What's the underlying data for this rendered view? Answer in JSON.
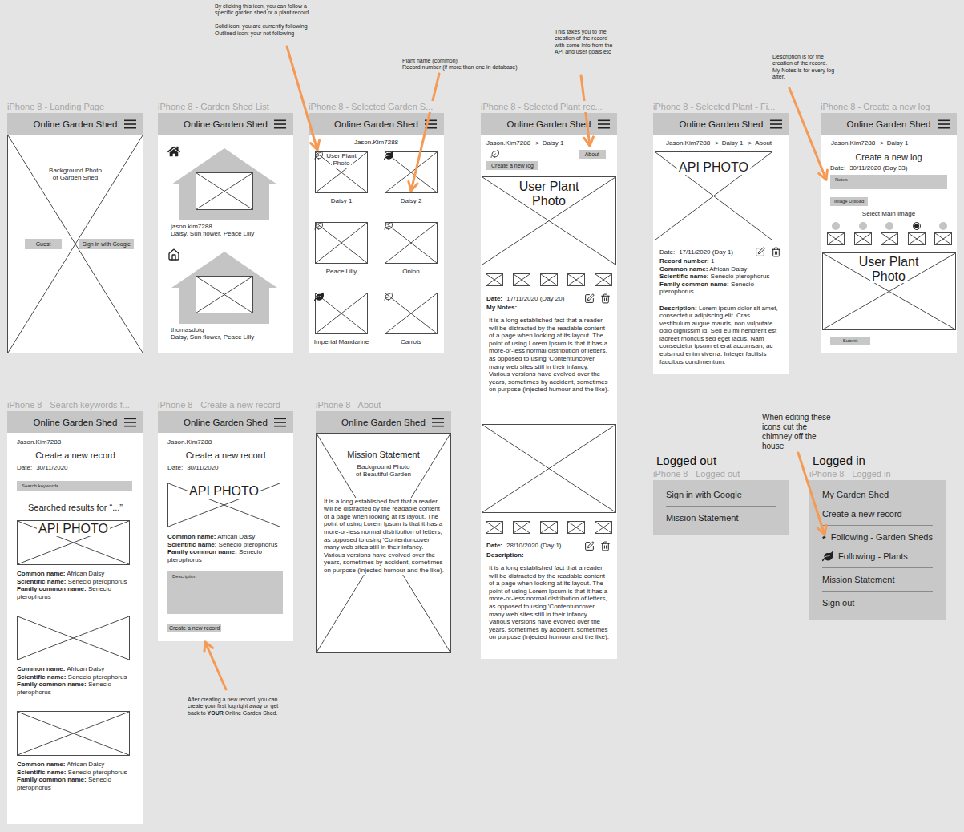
{
  "app_title": "Online Garden Shed",
  "landing": {
    "label": "iPhone 8 - Landing Page",
    "photo": [
      "Background Photo",
      "of Garden Shed"
    ],
    "buttons": [
      "Guest",
      "Sign in with Google"
    ]
  },
  "shed_list": {
    "label": "iPhone 8 - Garden Shed List",
    "sheds": [
      {
        "owner": "jason.kim7288",
        "plants": "Daisy, Sun flower, Peace Lilly",
        "following": true
      },
      {
        "owner": "thomasdoig",
        "plants": "Daisy, Sun flower, Peace Lilly",
        "following": false
      }
    ]
  },
  "selected_shed": {
    "label": "iPhone 8 - Selected Garden S...",
    "user": "Jason.Kim7288",
    "plants": [
      {
        "name": "Daisy 1",
        "photo": [
          "User Plant",
          "Photo"
        ],
        "following": false
      },
      {
        "name": "Daisy 2",
        "photo": [],
        "following": true
      },
      {
        "name": "Peace Lilly",
        "photo": [],
        "following": false
      },
      {
        "name": "Onion",
        "photo": [],
        "following": false
      },
      {
        "name": "Imperial Mandarine",
        "photo": [],
        "following": true
      },
      {
        "name": "Carrots",
        "photo": [],
        "following": false
      }
    ]
  },
  "plant_record": {
    "label": "iPhone 8 - Selected Plant rec...",
    "breadcrumb": [
      "Jason.Kim7288",
      "Daisy 1"
    ],
    "separator": ">",
    "about_button": "About",
    "following": false,
    "new_log_button": "Create a new log",
    "logs": [
      {
        "photo": [
          "User Plant",
          "Photo"
        ],
        "date_label": "Date:",
        "date": "17/11/2020 (Day 20)",
        "heading": "My Notes:",
        "text": "It is a long established fact that a reader will be distracted by the readable content of a page when looking at its layout. The point of using Lorem Ipsum is that it has a more-or-less normal distribution of letters, as opposed to using 'Contentuncover many web sites still in their infancy. Various versions have evolved over the years, sometimes by accident, sometimes on purpose (injected humour and the like)."
      },
      {
        "photo": [],
        "date_label": "Date:",
        "date": "28/10/2020 (Day 1)",
        "heading": "Description:",
        "text": "It is a long established fact that a reader will be distracted by the readable content of a page when looking at its layout. The point of using Lorem Ipsum is that it has a more-or-less normal distribution of letters, as opposed to using 'Contentuncover many web sites still in their infancy. Various versions have evolved over the years, sometimes by accident, sometimes on purpose (injected humour and the like)."
      }
    ]
  },
  "plant_about": {
    "label": "iPhone 8 - Selected Plant - Fi...",
    "breadcrumb": [
      "Jason.Kim7288",
      "Daisy 1",
      "About"
    ],
    "separator": ">",
    "photo": "API PHOTO",
    "date_label": "Date:",
    "date": "17/11/2020 (Day 1)",
    "fields": [
      {
        "label": "Record number:",
        "value": "1"
      },
      {
        "label": "Common name:",
        "value": "African Daisy"
      },
      {
        "label": "Scientific name:",
        "value": "Senecio pterophorus"
      },
      {
        "label": "Family common name:",
        "value": "Senecio pterophorus"
      }
    ],
    "description_label": "Description:",
    "description": "Lorem ipsum dolor sit amet, consectetur adipiscing elit. Cras vestibulum augue mauris, non vulputate odio dignissim id. Sed eu mi hendrerit est laoreet rhoncus sed eget lacus. Nam consectetur ipsum et erat accumsan, ac euismod enim viverra. Integer facilisis faucibus condimentum."
  },
  "new_log": {
    "label": "iPhone 8 - Create a new log",
    "breadcrumb": [
      "Jason.Kim7288",
      "Daisy 1"
    ],
    "separator": ">",
    "title": "Create a new log",
    "date_label": "Date:",
    "date": "30/11/2020 (Day 33)",
    "notes_placeholder": "Notes",
    "upload_button": "Image Upload",
    "select_label": "Select Main Image",
    "images": [
      {
        "selected": false
      },
      {
        "selected": false
      },
      {
        "selected": false
      },
      {
        "selected": true
      },
      {
        "selected": false
      }
    ],
    "photo": [
      "User Plant",
      "Photo"
    ],
    "submit": "Submit"
  },
  "search": {
    "label": "iPhone 8 - Search keywords f...",
    "user": "Jason.Kim7288",
    "title": "Create a new record",
    "date_label": "Date:",
    "date": "30/11/2020",
    "search_placeholder": "Search keywords",
    "results_title": "Searched results for “...”",
    "results": [
      {
        "photo": "API PHOTO",
        "fields": [
          {
            "label": "Common name:",
            "value": "African Daisy"
          },
          {
            "label": "Scientific name:",
            "value": "Senecio pterophorus"
          },
          {
            "label": "Family common name:",
            "value": "Senecio pterophorus"
          }
        ]
      },
      {
        "photo": "",
        "fields": [
          {
            "label": "Common name:",
            "value": "African Daisy"
          },
          {
            "label": "Scientific name:",
            "value": "Senecio pterophorus"
          },
          {
            "label": "Family common name:",
            "value": "Senecio pterophorus"
          }
        ]
      },
      {
        "photo": "",
        "fields": [
          {
            "label": "Common name:",
            "value": "African Daisy"
          },
          {
            "label": "Scientific name:",
            "value": "Senecio pterophorus"
          },
          {
            "label": "Family common name:",
            "value": "Senecio pterophorus"
          }
        ]
      }
    ]
  },
  "new_record": {
    "label": "iPhone 8 - Create a new record",
    "user": "Jason.Kim7288",
    "title": "Create a new record",
    "date_label": "Date:",
    "date": "30/11/2020",
    "photo": "API PHOTO",
    "fields": [
      {
        "label": "Common name:",
        "value": "African Daisy"
      },
      {
        "label": "Scientific name:",
        "value": "Senecio pterophorus"
      },
      {
        "label": "Family common name:",
        "value": "Senecio pterophorus"
      }
    ],
    "description_placeholder": "Description",
    "button": "Create a new record"
  },
  "about_page": {
    "label": "iPhone 8 - About",
    "title": "Mission Statement",
    "photo": [
      "Background Photo",
      "of Beautiful Garden"
    ],
    "text": "It is a long established fact that a reader will be distracted by the readable content of a page when looking at its layout. The point of using Lorem Ipsum is that it has a more-or-less normal distribution of letters, as opposed to using 'Contentuncover many web sites still in their infancy. Various versions have evolved over the years, sometimes by accident, sometimes on purpose (injected humour and the like)."
  },
  "menus": [
    {
      "heading": "Logged out",
      "label": "iPhone 8 - Logged out",
      "sections": [
        [
          {
            "text": "Sign in with Google",
            "kind": "link"
          }
        ],
        [
          {
            "text": "Mission Statement",
            "kind": "link"
          }
        ]
      ]
    },
    {
      "heading": "Logged in",
      "label": "iPhone 8 - Logged in",
      "sections": [
        [
          {
            "text": "My Garden Shed",
            "kind": "link"
          },
          {
            "text": "Create a new record",
            "kind": "link"
          }
        ],
        [
          {
            "text": "Following - Garden Sheds",
            "kind": "shed"
          },
          {
            "text": "Following - Plants",
            "kind": "plant"
          }
        ],
        [
          {
            "text": "Mission Statement",
            "kind": "link"
          }
        ],
        [
          {
            "text": "Sign out",
            "kind": "link"
          }
        ]
      ]
    }
  ],
  "annotations": [
    {
      "segments": [
        {
          "text": "By clicking this icon, you can follow a\nspecific garden shed or a plant record.\n\nSolid icon: you are currently following\nOutlined icon: your not following",
          "bold": false
        }
      ]
    },
    {
      "segments": [
        {
          "text": "Plant name (common)\nRecord number (if more than one in database)",
          "bold": false
        }
      ]
    },
    {
      "segments": [
        {
          "text": "This takes you to the\ncreation of the record\nwith some info from the\nAPI and user goals etc",
          "bold": false
        }
      ]
    },
    {
      "segments": [
        {
          "text": "Description is for the\ncreation of the record.\nMy Notes is for every log\nafter.",
          "bold": false
        }
      ]
    },
    {
      "segments": [
        {
          "text": "When editing these\nicons cut the\nchimney off the\nhouse",
          "bold": false
        }
      ]
    },
    {
      "segments": [
        {
          "text": "After creating a new record, you can\ncreate your first log right away or get\nback to ",
          "bold": false
        },
        {
          "text": "YOUR",
          "bold": true
        },
        {
          "text": " Online Garden Shed.",
          "bold": false
        }
      ]
    }
  ]
}
